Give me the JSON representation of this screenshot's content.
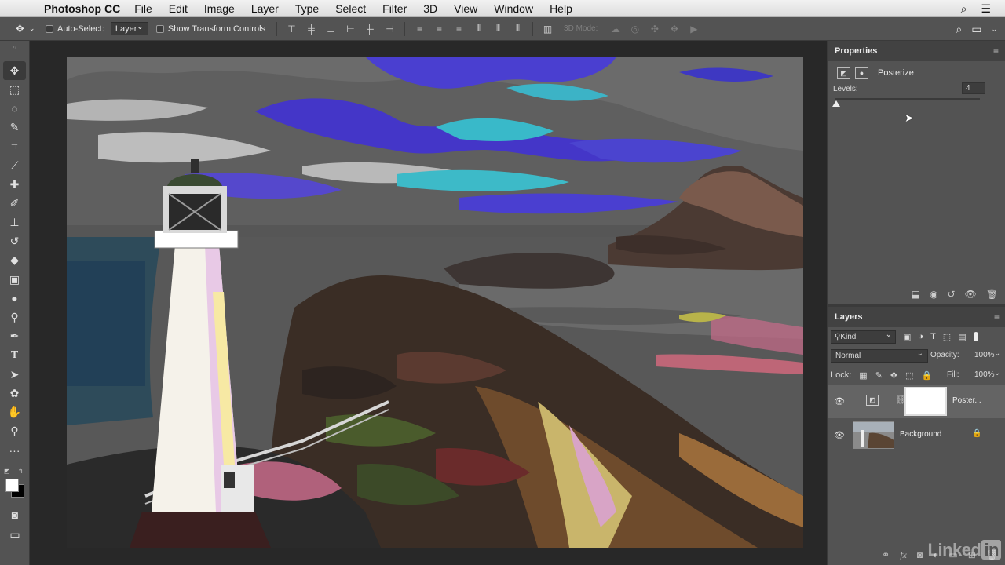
{
  "menubar": {
    "app_name": "Photoshop CC",
    "items": [
      "File",
      "Edit",
      "Image",
      "Layer",
      "Type",
      "Select",
      "Filter",
      "3D",
      "View",
      "Window",
      "Help"
    ],
    "right_icons": [
      "search-icon",
      "list-icon"
    ]
  },
  "options_bar": {
    "auto_select_label": "Auto-Select:",
    "auto_select_value": "Layer",
    "show_transform_label": "Show Transform Controls",
    "mode_3d_label": "3D Mode:"
  },
  "tools": [
    "move",
    "marquee",
    "lasso",
    "quick-select",
    "crop",
    "eyedropper",
    "healing",
    "brush",
    "clone-stamp",
    "history-brush",
    "eraser",
    "gradient",
    "blur",
    "dodge",
    "pen",
    "type",
    "path-select",
    "shape",
    "hand",
    "zoom",
    "more"
  ],
  "properties": {
    "tab_label": "Properties",
    "adjustment_name": "Posterize",
    "levels_label": "Levels:",
    "levels_value": "4",
    "levels_min": 2,
    "levels_max": 255
  },
  "layers": {
    "tab_label": "Layers",
    "filter_kind": "Kind",
    "blend_mode": "Normal",
    "opacity_label": "Opacity:",
    "opacity_value": "100%",
    "lock_label": "Lock:",
    "fill_label": "Fill:",
    "fill_value": "100%",
    "items": [
      {
        "name": "Poster...",
        "selected": true
      },
      {
        "name": "Background",
        "selected": false
      }
    ]
  },
  "watermark": {
    "text": "Linked",
    "suffix": "in"
  },
  "colors": {
    "panel_bg": "#535353",
    "canvas_bg": "#282828",
    "tab_bg": "#424242"
  }
}
